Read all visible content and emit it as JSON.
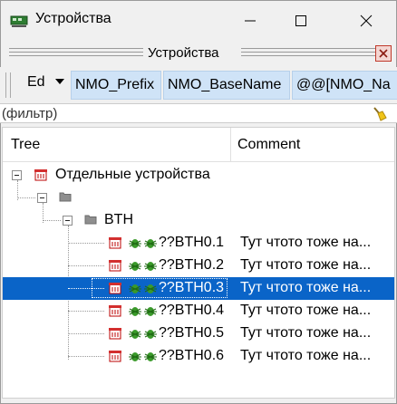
{
  "window": {
    "title": "Устройства",
    "icon": "app-icon"
  },
  "dock": {
    "title": "Устройства"
  },
  "toolbar": {
    "dropdown_value": "Ed",
    "columns": [
      "NMO_Prefix",
      "NMO_BaseName",
      "@@[NMO_Na"
    ]
  },
  "filter": {
    "placeholder": "(фильтр)"
  },
  "tree": {
    "headers": {
      "tree": "Tree",
      "comment": "Comment"
    },
    "root": {
      "label": "Отдельные устройства",
      "icon": "device-group-icon"
    },
    "group_label": "",
    "bth": {
      "label": "BTH",
      "icon": "folder-icon"
    },
    "devices": [
      {
        "label": "??BTH0.1",
        "comment": "Тут чтото тоже на...",
        "selected": false
      },
      {
        "label": "??BTH0.2",
        "comment": "Тут чтото тоже на...",
        "selected": false
      },
      {
        "label": "??BTH0.3",
        "comment": "Тут чтото тоже на...",
        "selected": true
      },
      {
        "label": "??BTH0.4",
        "comment": "Тут чтото тоже на...",
        "selected": false
      },
      {
        "label": "??BTH0.5",
        "comment": "Тут чтото тоже на...",
        "selected": false
      },
      {
        "label": "??BTH0.6",
        "comment": "Тут чтото тоже на...",
        "selected": false
      }
    ]
  },
  "colors": {
    "selection": "#0a64c8",
    "column_chip": "#cfe3f7",
    "status_green": "#3a9a2a"
  }
}
